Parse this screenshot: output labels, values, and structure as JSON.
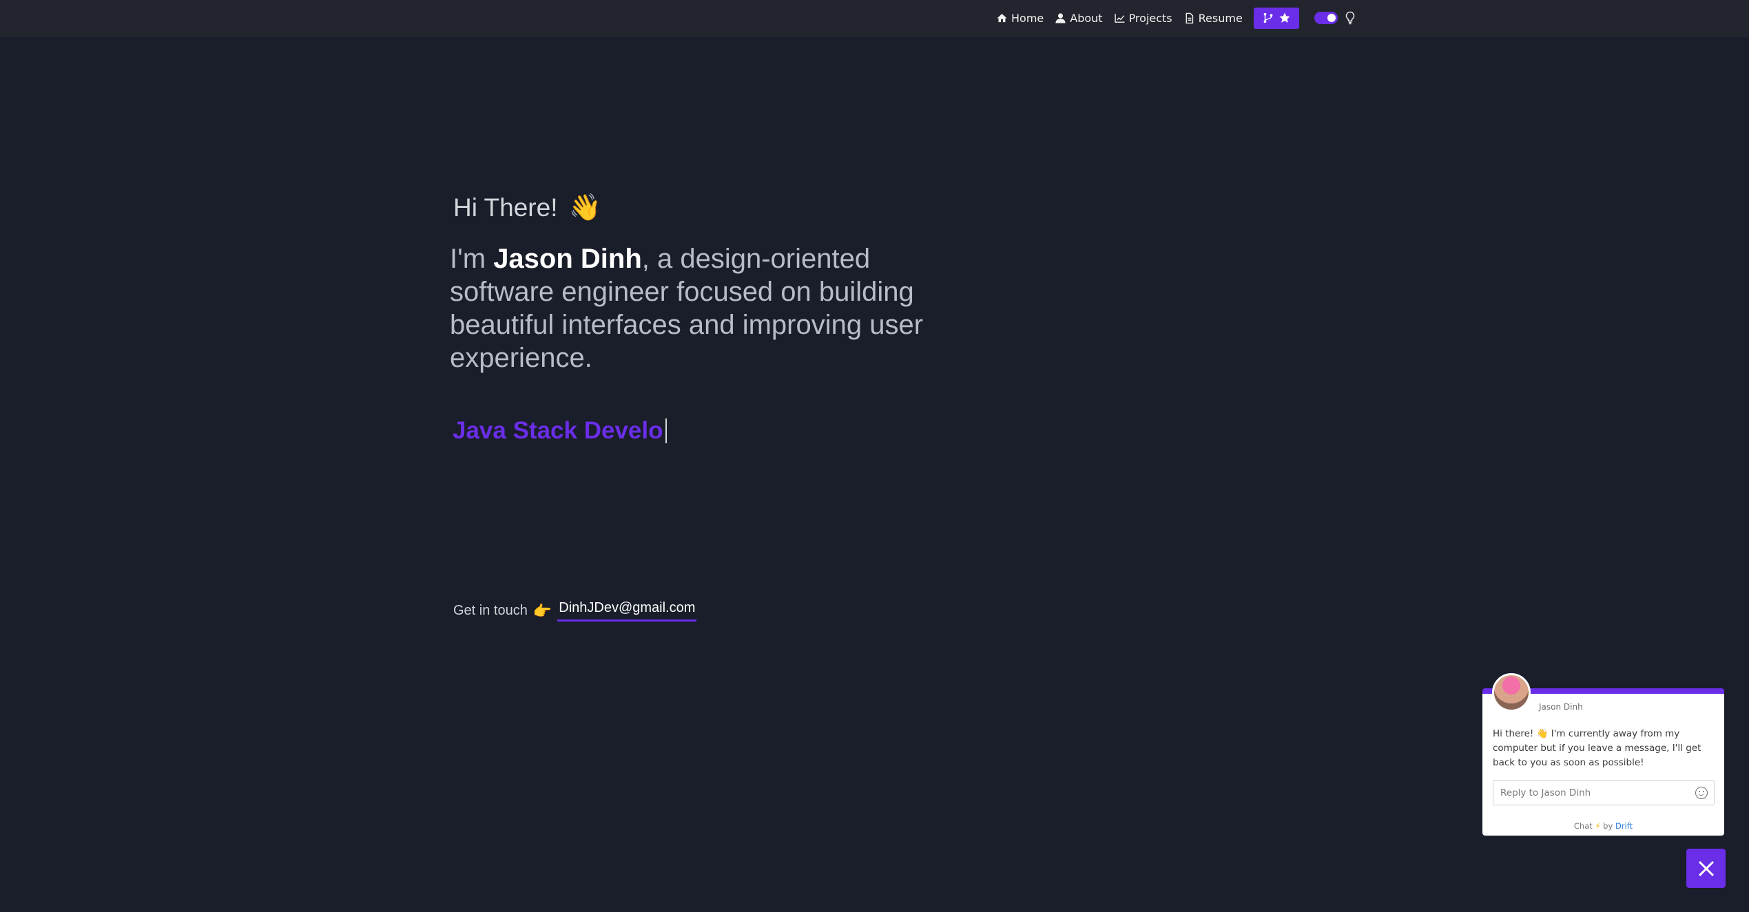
{
  "nav": {
    "items": [
      {
        "label": "Home",
        "icon": "home-icon"
      },
      {
        "label": "About",
        "icon": "user-icon"
      },
      {
        "label": "Projects",
        "icon": "chart-line-icon"
      },
      {
        "label": "Resume",
        "icon": "file-icon"
      }
    ],
    "github_button_icons": [
      "git-fork-icon",
      "star-icon"
    ],
    "theme_toggle_on": true,
    "accent_color": "#6a2ee8"
  },
  "hero": {
    "greeting": "Hi There!",
    "wave_emoji": "👋",
    "intro_prefix": "I'm ",
    "intro_name": "Jason Dinh",
    "intro_suffix": ", a design-oriented software engineer focused on building beautiful interfaces and improving user experience.",
    "typed_text": "Java Stack Develo"
  },
  "contact": {
    "label": "Get in touch",
    "point_emoji": "👉",
    "email": "DinhJDev@gmail.com"
  },
  "chat": {
    "sender": "Jason Dinh",
    "message": "Hi there! 👋 I'm currently away from my computer but if you leave a message, I'll get back to you as soon as possible!",
    "input_placeholder": "Reply to Jason Dinh",
    "footer_prefix": "Chat",
    "footer_bolt": "⚡",
    "footer_by": "by",
    "footer_brand": "Drift"
  }
}
